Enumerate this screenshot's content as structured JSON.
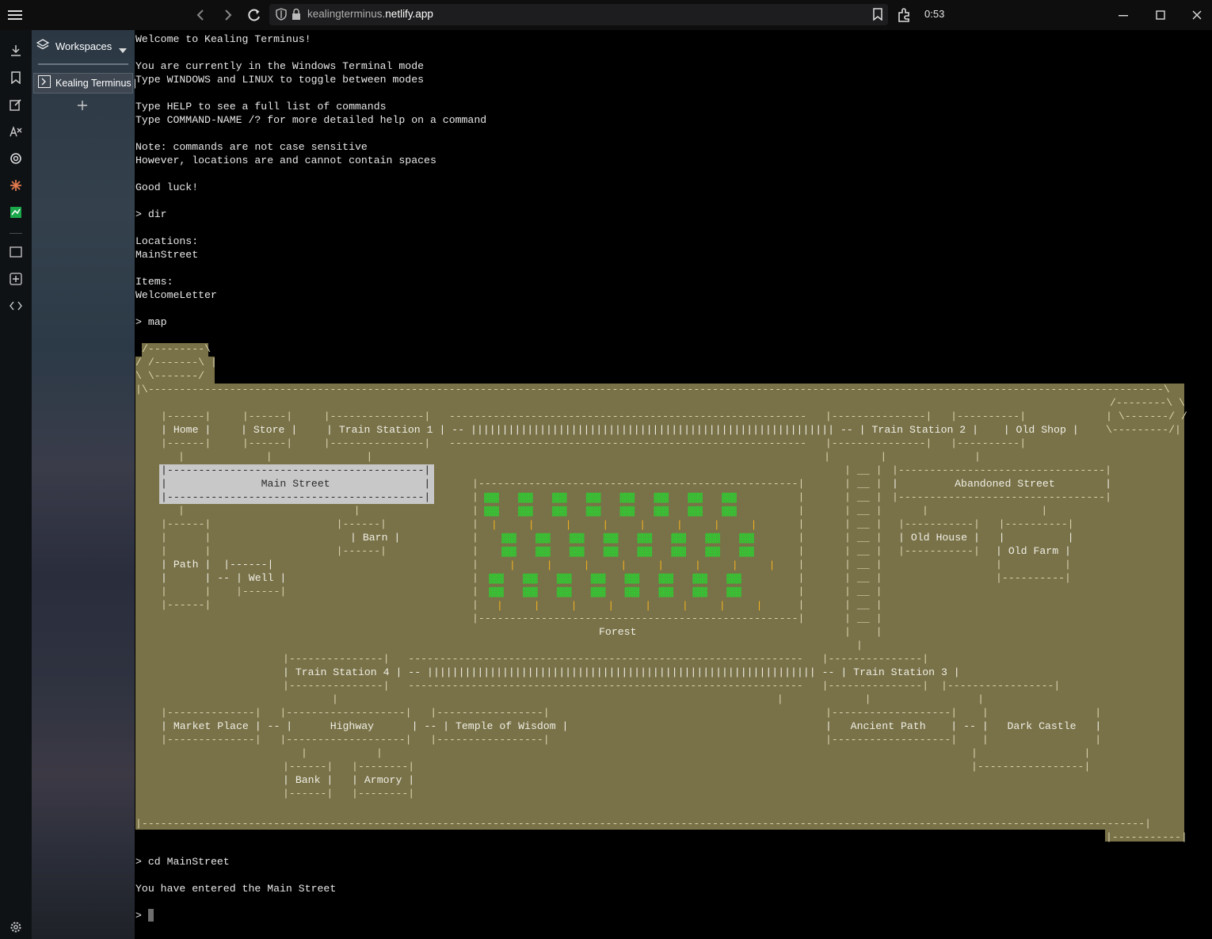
{
  "browser": {
    "url_prefix": "kealingterminus.",
    "url_domain": "netlify.app",
    "clock": "0:53"
  },
  "panel": {
    "workspaces_label": "Workspaces",
    "tab_label": "Kealing Terminus |"
  },
  "terminal": {
    "lines": [
      "Welcome to Kealing Terminus!",
      "",
      "You are currently in the Windows Terminal mode",
      "Type WINDOWS and LINUX to toggle between modes",
      "",
      "Type HELP to see a full list of commands",
      "Type COMMAND-NAME /? for more detailed help on a command",
      "",
      "Note: commands are not case sensitive",
      "However, locations are and cannot contain spaces",
      "",
      "Good luck!",
      "",
      "> dir",
      "",
      "Locations:",
      "MainStreet",
      "",
      "Items:",
      "WelcomeLetter",
      "",
      "> map"
    ],
    "after_map": [
      "> cd MainStreet",
      "",
      "You have entered the Main Street",
      "",
      "> "
    ]
  },
  "map": {
    "labels": {
      "home": "Home",
      "store": "Store",
      "train1": "Train Station 1",
      "train2": "Train Station 2",
      "oldshop": "Old Shop",
      "mainstreet": "Main Street",
      "abandoned": "Abandoned Street",
      "barn": "Barn",
      "path": "Path",
      "well": "Well",
      "oldhouse": "Old House",
      "oldfarm": "Old Farm",
      "forest": "Forest",
      "train4": "Train Station 4",
      "train3": "Train Station 3",
      "market": "Market Place",
      "highway": "Highway",
      "temple": "Temple of Wisdom",
      "ancient": "Ancient Path",
      "castle": "Dark Castle",
      "bank": "Bank",
      "armory": "Armory"
    }
  },
  "colors": {
    "map_bg": "#797147",
    "terminal_bg": "#000000",
    "tree": "#32c832",
    "trunk": "#f0b020",
    "highlight": "#c8c8c8"
  }
}
